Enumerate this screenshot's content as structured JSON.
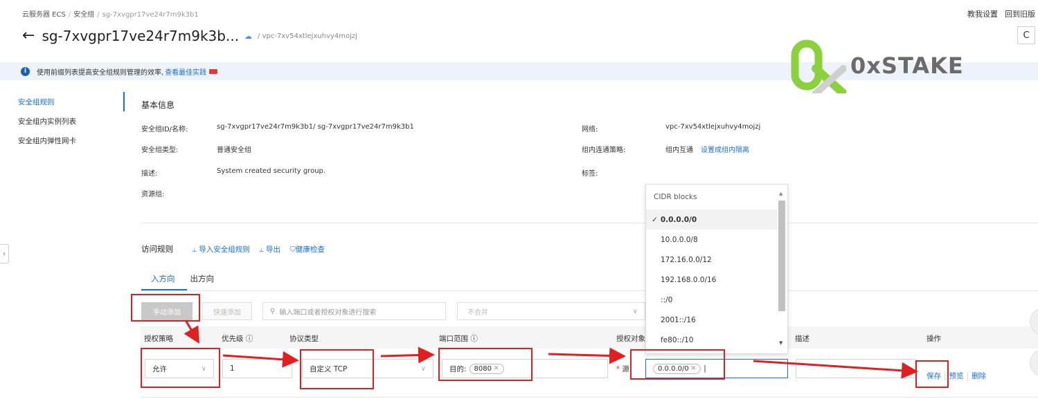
{
  "breadcrumb": [
    "云服务器 ECS",
    "安全组",
    "sg-7xvgpr17ve24r7m9k3b1"
  ],
  "topright": [
    "教我设置",
    "回到旧版"
  ],
  "header": {
    "title": "sg-7xvgpr17ve24r7m9k3b...",
    "subtitle": "/ vpc-7xv54xtlejxuhvy4mojzj",
    "refresh_icon": "C"
  },
  "banner": {
    "text": "使用前缀列表提高安全组规则管理的效率,",
    "link": "查看最佳实践",
    "info_icon": "i"
  },
  "logo": {
    "text": "0xSTAKE"
  },
  "sidebar": {
    "items": [
      {
        "label": "安全组规则",
        "active": true
      },
      {
        "label": "安全组内实例列表",
        "active": false
      },
      {
        "label": "安全组内弹性网卡",
        "active": false
      }
    ]
  },
  "basic_info": {
    "title": "基本信息",
    "left": [
      {
        "label": "安全组ID/名称:",
        "value": "sg-7xvgpr17ve24r7m9k3b1/ sg-7xvgpr17ve24r7m9k3b1"
      },
      {
        "label": "安全组类型:",
        "value": "普通安全组"
      },
      {
        "label": "描述:",
        "value": "System created security group."
      },
      {
        "label": "资源组:",
        "value": ""
      }
    ],
    "right": [
      {
        "label": "网络:",
        "value": "vpc-7xv54xtlejxuhvy4mojzj",
        "link": ""
      },
      {
        "label": "组内连通策略:",
        "value": "组内互通",
        "link": "设置成组内隔离"
      },
      {
        "label": "标签:",
        "value": "",
        "link": ""
      }
    ]
  },
  "rules": {
    "title": "访问规则",
    "actions": [
      "导入安全组规则",
      "导出",
      "健康检查"
    ],
    "action_icons": [
      "import-icon",
      "export-icon",
      "shield-check-icon"
    ],
    "tabs": [
      {
        "label": "入方向",
        "active": true
      },
      {
        "label": "出方向",
        "active": false
      }
    ],
    "toolbar": {
      "manual_add": "手动添加",
      "quick_add": "快速添加",
      "search_placeholder": "输入端口或者授权对象进行搜索",
      "merge_select": "不合并"
    },
    "columns": [
      "授权策略",
      "优先级 ⓘ",
      "协议类型",
      "端口范围 ⓘ",
      "授权对象",
      "描述",
      "操作"
    ],
    "row": {
      "policy": "允许",
      "priority": "1",
      "protocol": "自定义 TCP",
      "port_prefix": "目的:",
      "port_tag": "8080",
      "source_prefix": "源:",
      "source_tag": "0.0.0.0/0",
      "description": "",
      "ops": [
        "保存",
        "预览",
        "删除"
      ]
    }
  },
  "dropdown": {
    "header": "CIDR blocks",
    "items": [
      {
        "label": "0.0.0.0/0",
        "selected": true,
        "check": "✓"
      },
      {
        "label": "10.0.0.0/8",
        "selected": false
      },
      {
        "label": "172.16.0.0/12",
        "selected": false
      },
      {
        "label": "192.168.0.0/16",
        "selected": false
      },
      {
        "label": "::/0",
        "selected": false
      },
      {
        "label": "2001::/16",
        "selected": false
      },
      {
        "label": "fe80::/10",
        "selected": false
      }
    ]
  },
  "colors": {
    "accent": "#1a6fd6",
    "annotation_red": "#e02020",
    "logo_green": "#8bd13e"
  }
}
